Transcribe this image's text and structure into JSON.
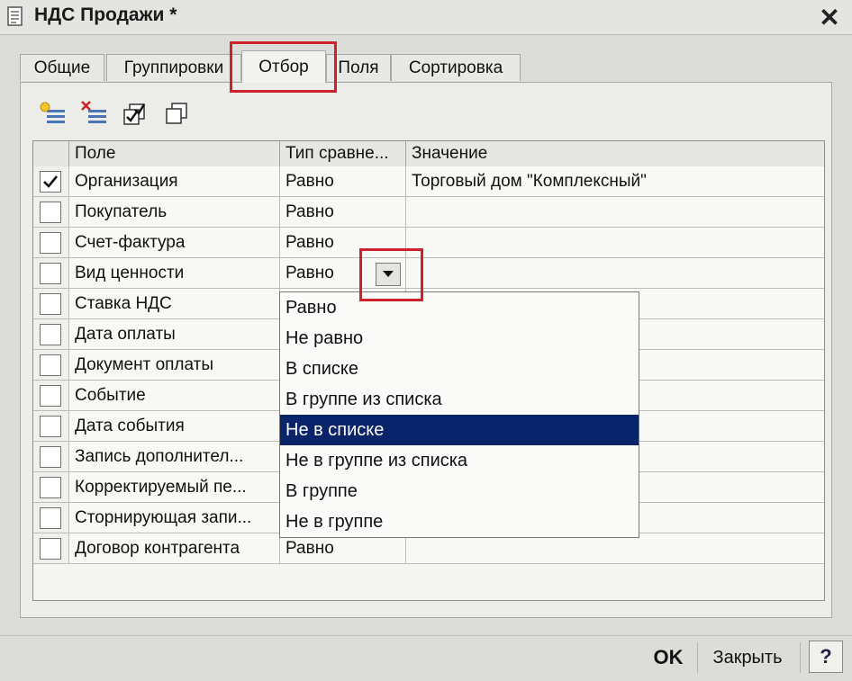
{
  "window": {
    "title": "НДС Продажи *"
  },
  "tabs": [
    {
      "label": "Общие"
    },
    {
      "label": "Группировки"
    },
    {
      "label": "Отбор"
    },
    {
      "label": "Поля"
    },
    {
      "label": "Сортировка"
    }
  ],
  "active_tab": "Отбор",
  "toolbar": {
    "icons": [
      "add-rows-icon",
      "delete-rows-icon",
      "check-all-icon",
      "copy-icon"
    ]
  },
  "grid": {
    "columns": [
      "Поле",
      "Тип сравне...",
      "Значение"
    ],
    "rows": [
      {
        "checked": true,
        "field": "Организация",
        "comparison": "Равно",
        "value": "Торговый дом \"Комплексный\""
      },
      {
        "checked": false,
        "field": "Покупатель",
        "comparison": "Равно",
        "value": ""
      },
      {
        "checked": false,
        "field": "Счет-фактура",
        "comparison": "Равно",
        "value": ""
      },
      {
        "checked": false,
        "field": "Вид ценности",
        "comparison": "Равно",
        "value": ""
      },
      {
        "checked": false,
        "field": "Ставка НДС",
        "comparison": "",
        "value": ""
      },
      {
        "checked": false,
        "field": "Дата оплаты",
        "comparison": "",
        "value": ""
      },
      {
        "checked": false,
        "field": "Документ оплаты",
        "comparison": "",
        "value": ""
      },
      {
        "checked": false,
        "field": "Событие",
        "comparison": "",
        "value": ""
      },
      {
        "checked": false,
        "field": "Дата события",
        "comparison": "",
        "value": ""
      },
      {
        "checked": false,
        "field": "Запись дополнител...",
        "comparison": "",
        "value": ""
      },
      {
        "checked": false,
        "field": "Корректируемый пе...",
        "comparison": "",
        "value": ""
      },
      {
        "checked": false,
        "field": "Сторнирующая запи...",
        "comparison": "",
        "value": ""
      },
      {
        "checked": false,
        "field": "Договор контрагента",
        "comparison": "Равно",
        "value": ""
      }
    ]
  },
  "dropdown": {
    "options": [
      "Равно",
      "Не равно",
      "В списке",
      "В группе из списка",
      "Не в списке",
      "Не в группе из списка",
      "В группе",
      "Не в группе"
    ],
    "selected_index": 4
  },
  "footer": {
    "ok_label": "OK",
    "close_label": "Закрыть",
    "help_label": "?"
  },
  "colors": {
    "highlight": "#d0202a",
    "selection": "#0a246a"
  }
}
